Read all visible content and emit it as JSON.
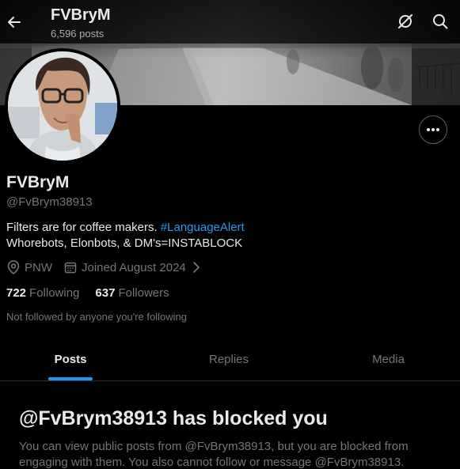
{
  "header": {
    "title": "FVBryM",
    "subtitle": "6,596 posts",
    "back_icon": "arrow-left-icon",
    "grok_icon": "grok-icon",
    "search_icon": "search-icon"
  },
  "profile": {
    "display_name": "FVBryM",
    "handle": "@FvBrym38913",
    "bio_line1_text": "Filters are for coffee makers. ",
    "bio_hashtag": "#LanguageAlert",
    "bio_line2": "Whorebots, Elonbots, & DM's=INSTABLOCK",
    "location": "PNW",
    "joined": "Joined August 2024",
    "following_count": "722",
    "following_label": "Following",
    "followers_count": "637",
    "followers_label": "Followers",
    "followed_note": "Not followed by anyone you're following"
  },
  "tabs": [
    {
      "label": "Posts",
      "active": true
    },
    {
      "label": "Replies",
      "active": false
    },
    {
      "label": "Media",
      "active": false
    }
  ],
  "blocked": {
    "title": "@FvBrym38913 has blocked you",
    "message": "You can view public posts from @FvBrym38913, but you are blocked from engaging with them. You also cannot follow or message @FvBrym38913."
  },
  "colors": {
    "accent": "#1d9bf0",
    "background": "#000000",
    "muted_text": "#71767b",
    "primary_text": "#e7e9ea",
    "border": "#2f3336"
  }
}
